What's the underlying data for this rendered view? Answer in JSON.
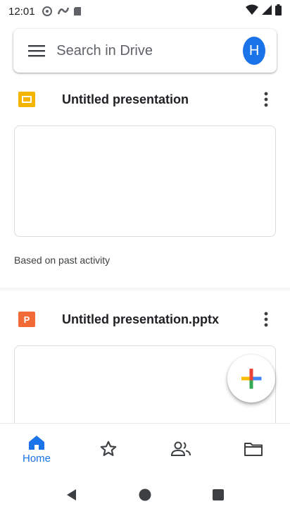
{
  "status_bar": {
    "time": "12:01"
  },
  "search": {
    "placeholder": "Search in Drive"
  },
  "account": {
    "avatar_letter": "H"
  },
  "files": [
    {
      "name": "Untitled presentation",
      "type": "slides",
      "icon_color": "#f4b400"
    },
    {
      "name": "Untitled presentation.pptx",
      "type": "pptx",
      "icon_letter": "P",
      "icon_color": "#f26b36"
    }
  ],
  "suggestion_caption": "Based on past activity",
  "bottom_nav": {
    "items": [
      {
        "label": "Home",
        "icon": "home-icon",
        "active": true
      },
      {
        "label": "",
        "icon": "star-icon"
      },
      {
        "label": "",
        "icon": "shared-people-icon"
      },
      {
        "label": "",
        "icon": "folder-icon"
      }
    ]
  },
  "colors": {
    "accent": "#1a73e8",
    "fab_plus_colors": [
      "#ea4335",
      "#4285f4",
      "#34a853",
      "#fbbc04"
    ]
  }
}
